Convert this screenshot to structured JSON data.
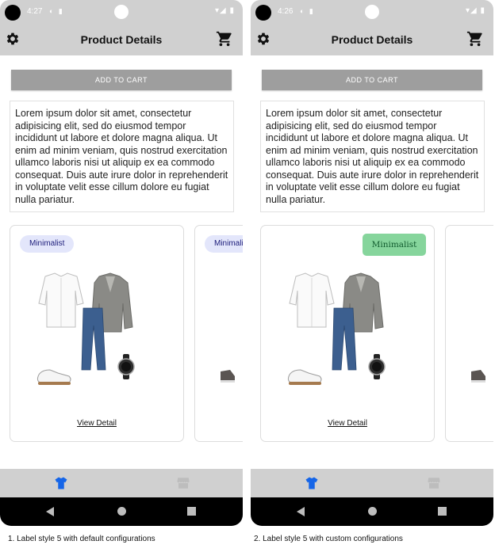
{
  "phones": [
    {
      "status": {
        "time": "4:27"
      },
      "title": "Product Details",
      "add_to_cart": "ADD TO CART",
      "description": "Lorem ipsum dolor sit amet, consectetur adipisicing elit, sed do eiusmod tempor incididunt ut labore et dolore magna aliqua. Ut enim ad minim veniam, quis nostrud exercitation ullamco laboris nisi ut aliquip ex ea commodo consequat. Duis aute irure dolor in reprehenderit in voluptate velit esse cillum dolore eu fugiat nulla pariatur.",
      "card": {
        "label": "Minimalist",
        "view_detail": "View Detail"
      },
      "next_card_label": "Minimalist"
    },
    {
      "status": {
        "time": "4:26"
      },
      "title": "Product Details",
      "add_to_cart": "ADD TO CART",
      "description": "Lorem ipsum dolor sit amet, consectetur adipisicing elit, sed do eiusmod tempor incididunt ut labore et dolore magna aliqua. Ut enim ad minim veniam, quis nostrud exercitation ullamco laboris nisi ut aliquip ex ea commodo consequat. Duis aute irure dolor in reprehenderit in voluptate velit esse cillum dolore eu fugiat nulla pariatur.",
      "card": {
        "label": "Minimalist",
        "view_detail": "View Detail"
      }
    }
  ],
  "captions": [
    "1. Label style 5 with default configurations",
    "2. Label style 5 with custom configurations"
  ],
  "icons": {
    "settings": "gear-icon",
    "cart": "cart-icon",
    "nav_left": "shirt-icon",
    "nav_right": "store-icon"
  },
  "colors": {
    "bar_gray": "#d0d0d0",
    "button_gray": "#9e9e9e",
    "default_label_bg": "#e3e6fb",
    "default_label_text": "#1c1c7a",
    "custom_label_bg": "#86d59c",
    "custom_label_text": "#115b2e",
    "nav_active": "#1565e8"
  }
}
